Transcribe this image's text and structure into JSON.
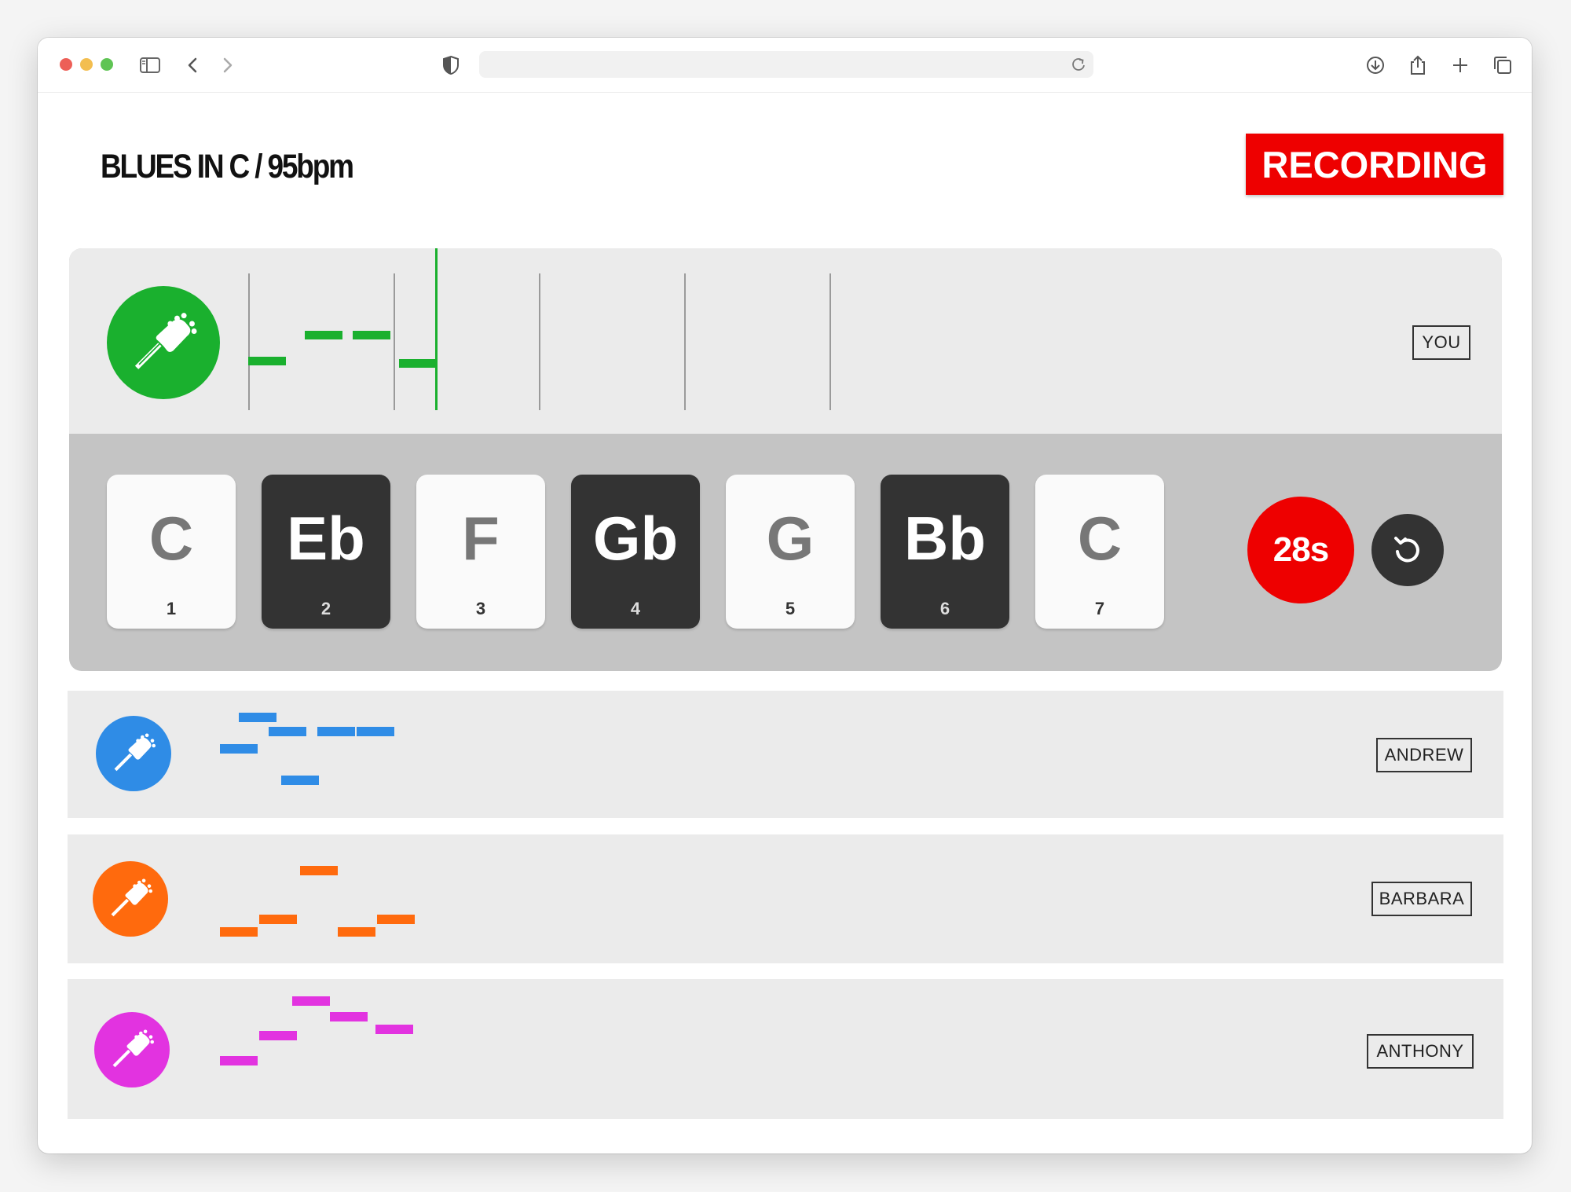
{
  "browser": {
    "url": "",
    "icons": [
      "sidebar-icon",
      "back-icon",
      "forward-icon",
      "shield-icon",
      "reload-icon",
      "download-icon",
      "share-icon",
      "new-tab-icon",
      "tabs-icon"
    ]
  },
  "header": {
    "title": "BLUES IN C / 95bpm",
    "status": "RECORDING",
    "status_color": "#ee0000"
  },
  "you_track": {
    "player": "YOU",
    "color": "#1ab02e",
    "icon": "guitar-headstock-icon"
  },
  "scale_keys": [
    {
      "note": "C",
      "number": "1",
      "style": "white"
    },
    {
      "note": "Eb",
      "number": "2",
      "style": "black"
    },
    {
      "note": "F",
      "number": "3",
      "style": "white"
    },
    {
      "note": "Gb",
      "number": "4",
      "style": "black"
    },
    {
      "note": "G",
      "number": "5",
      "style": "white"
    },
    {
      "note": "Bb",
      "number": "6",
      "style": "black"
    },
    {
      "note": "C",
      "number": "7",
      "style": "white"
    }
  ],
  "controls": {
    "timer": "28s",
    "timer_color": "#ee0000",
    "reset_icon": "reset-icon"
  },
  "other_tracks": [
    {
      "player": "ANDREW",
      "color": "#2f8ce6",
      "icon": "guitar-headstock-icon"
    },
    {
      "player": "BARBARA",
      "color": "#ff6a0d",
      "icon": "guitar-headstock-icon"
    },
    {
      "player": "ANTHONY",
      "color": "#e233e0",
      "icon": "guitar-headstock-icon"
    }
  ]
}
